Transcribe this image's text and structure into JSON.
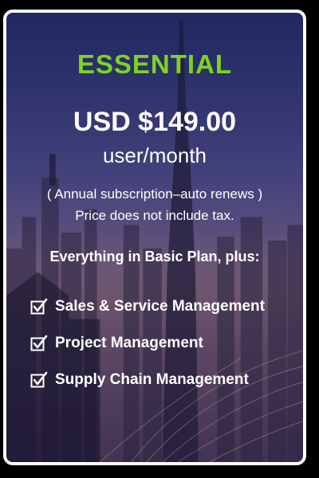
{
  "plan": {
    "name": "ESSENTIAL",
    "price": "USD $149.00",
    "period": "user/month",
    "note_billing": "( Annual subscription–auto renews )",
    "note_tax": "Price does not include tax.",
    "includes_heading": "Everything in Basic Plan, plus:",
    "features": [
      {
        "label": "Sales & Service Management",
        "icon": "checkbox-check-icon"
      },
      {
        "label": "Project Management",
        "icon": "checkbox-check-icon"
      },
      {
        "label": "Supply Chain Management",
        "icon": "checkbox-check-icon"
      }
    ]
  },
  "colors": {
    "plan_name": "#7ed321",
    "text": "#ffffff",
    "border": "#ffffff",
    "page_background": "#000000"
  }
}
